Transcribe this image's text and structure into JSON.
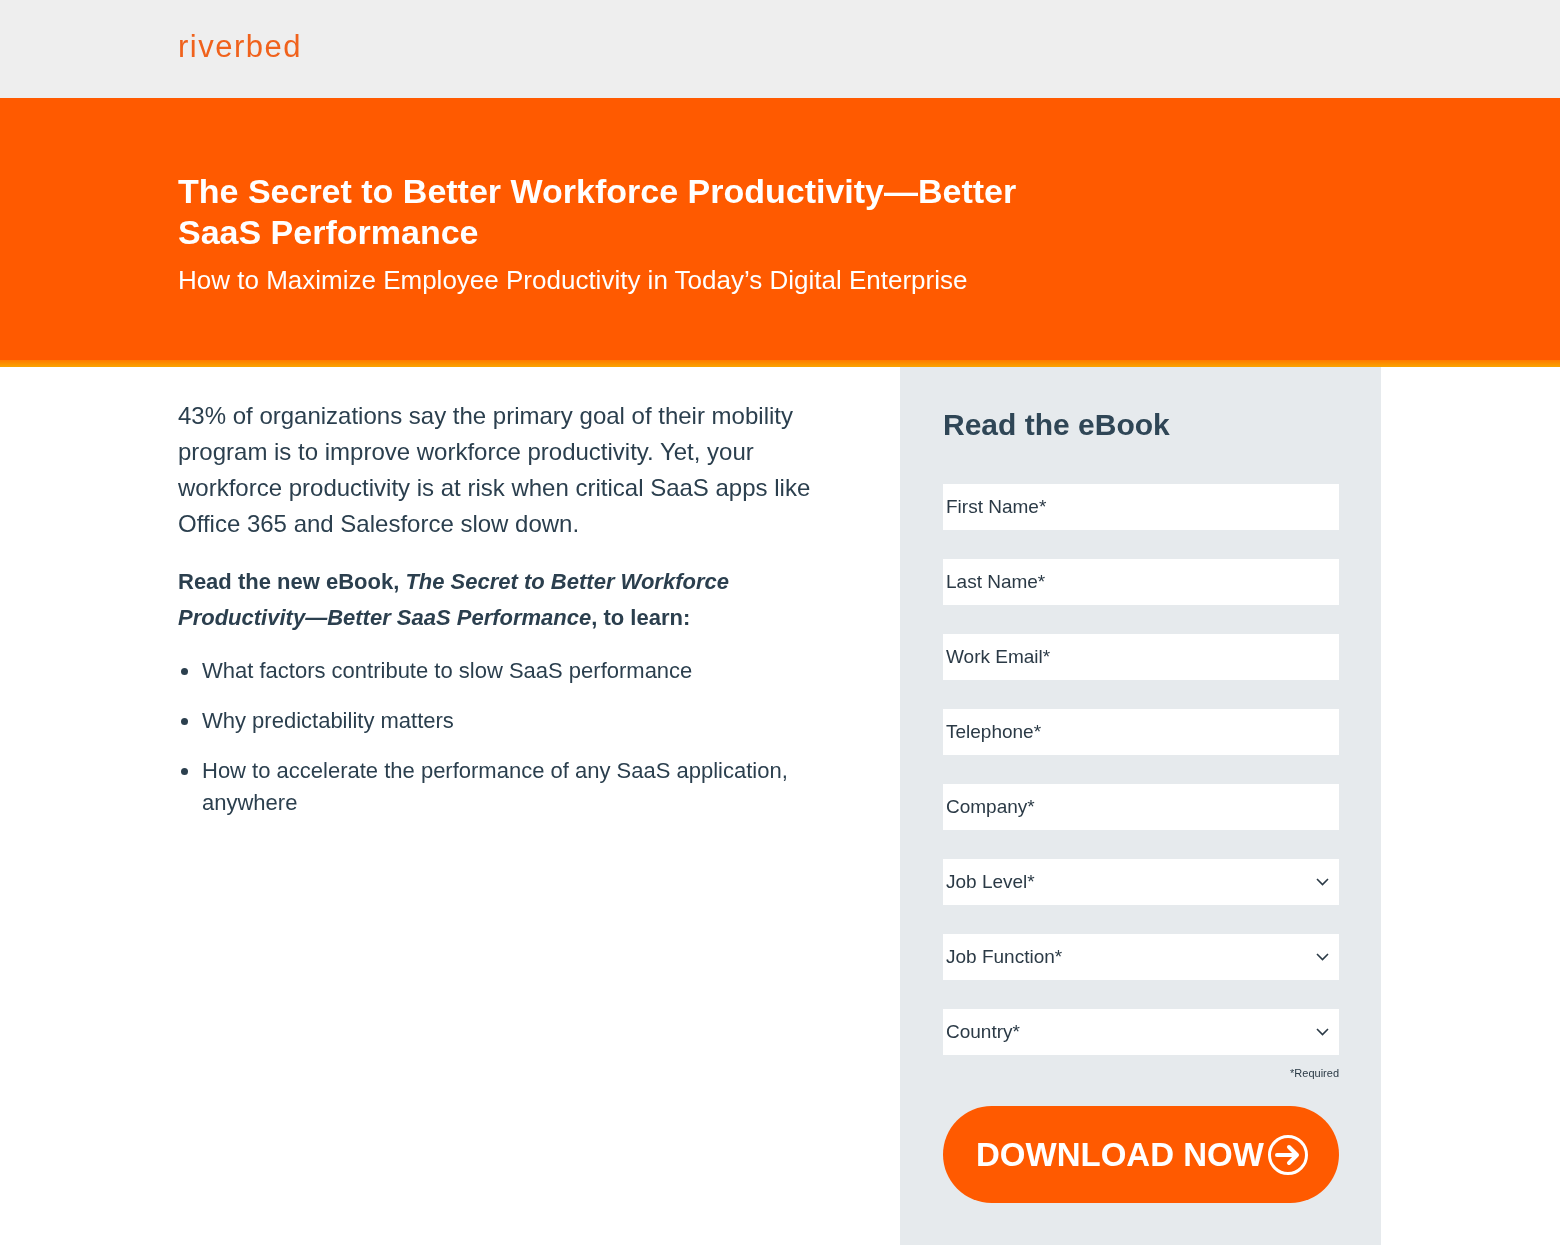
{
  "header": {
    "logo": "riverbed"
  },
  "banner": {
    "title": "The Secret to Better Workforce Productivity—Better SaaS Performance",
    "subtitle": "How to Maximize Employee Productivity in Today’s Digital Enterprise"
  },
  "intro": {
    "paragraph": "43% of organizations say the primary goal of their mobility program is to improve workforce productivity. Yet, your workforce productivity is at risk when critical SaaS apps like Office 365 and Salesforce slow down.",
    "lead": "Read the new eBook, *The Secret to Better Workforce Productivity—Better SaaS Performance*, to learn:",
    "bullets": [
      "What factors contribute to slow SaaS performance",
      "Why predictability matters",
      "How to accelerate the performance of any SaaS application, anywhere"
    ]
  },
  "form": {
    "title": "Read the eBook",
    "fields": [
      {
        "kind": "text",
        "placeholder": "First Name*"
      },
      {
        "kind": "text",
        "placeholder": "Last Name*"
      },
      {
        "kind": "text",
        "placeholder": "Work Email*"
      },
      {
        "kind": "text",
        "placeholder": "Telephone*"
      },
      {
        "kind": "text",
        "placeholder": "Company*"
      },
      {
        "kind": "select",
        "placeholder": "Job Level*"
      },
      {
        "kind": "select",
        "placeholder": "Job Function*"
      },
      {
        "kind": "select",
        "placeholder": "Country*"
      }
    ],
    "required_note": "*Required",
    "submit": "DOWNLOAD NOW"
  }
}
